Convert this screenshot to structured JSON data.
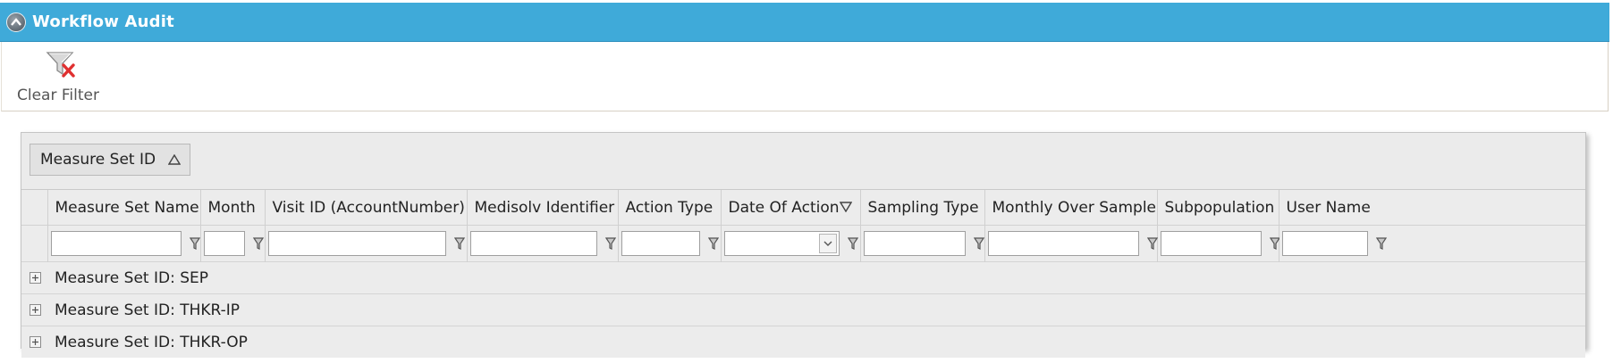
{
  "window": {
    "title": "Workflow Audit"
  },
  "toolbar": {
    "clear_filter_label": "Clear Filter"
  },
  "group_panel": {
    "group_by": "Measure Set ID",
    "sort": "ascending"
  },
  "columns": [
    {
      "label": "Measure Set Name"
    },
    {
      "label": "Month"
    },
    {
      "label": "Visit ID (AccountNumber)"
    },
    {
      "label": "Medisolv Identifier"
    },
    {
      "label": "Action Type"
    },
    {
      "label": "Date Of Action",
      "sort": "descending"
    },
    {
      "label": "Sampling Type"
    },
    {
      "label": "Monthly Over Sample"
    },
    {
      "label": "Subpopulation"
    },
    {
      "label": "User Name"
    }
  ],
  "filters": {
    "value": ""
  },
  "groups": [
    {
      "label": "Measure Set ID: SEP"
    },
    {
      "label": "Measure Set ID: THKR-IP"
    },
    {
      "label": "Measure Set ID: THKR-OP"
    }
  ],
  "colors": {
    "header_blue": "#3faad9",
    "grid_bg": "#ebebeb",
    "clear_x_red": "#e03030"
  }
}
